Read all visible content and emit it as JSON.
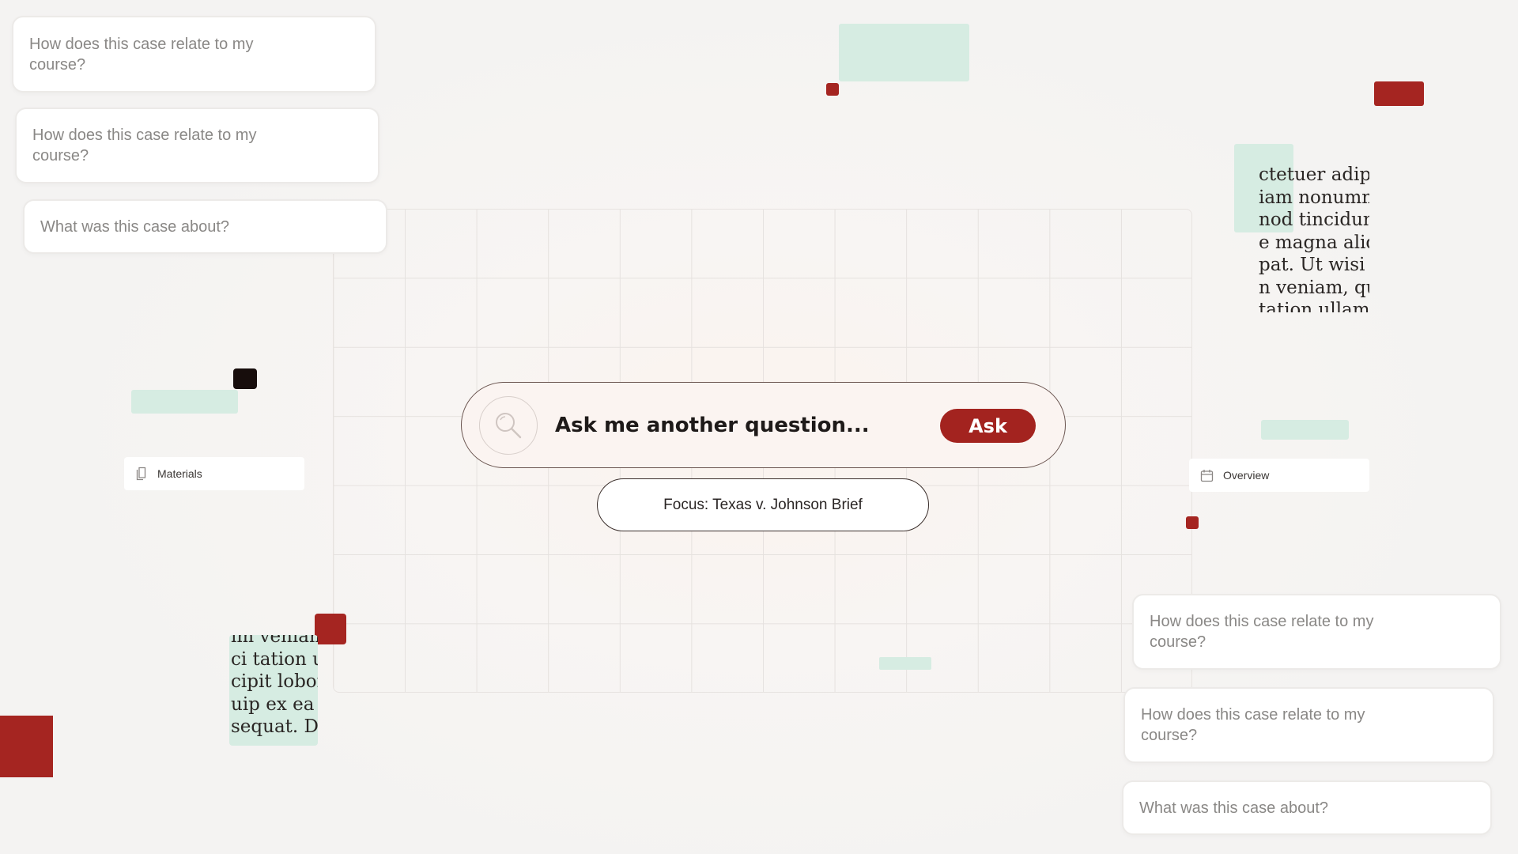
{
  "questions_left": [
    {
      "text": "How does this case relate to my course?"
    },
    {
      "text": "How does this case relate to my course?"
    },
    {
      "text": "What was this case about?"
    }
  ],
  "questions_right": [
    {
      "text": "How does this case relate to my course?"
    },
    {
      "text": "How does this case relate to my course?"
    },
    {
      "text": "What was this case about?"
    }
  ],
  "search": {
    "placeholder": "Ask me another question...",
    "button_label": "Ask",
    "icon": "search-icon"
  },
  "focus": {
    "label": "Focus: Texas v. Johnson Brief"
  },
  "tags": {
    "materials": {
      "label": "Materials",
      "icon": "document-icon"
    },
    "overview": {
      "label": "Overview",
      "icon": "calendar-icon"
    }
  },
  "snippets": {
    "top_right": [
      "ctetuer adip",
      "iam nonumm",
      "nod tincidunt",
      "e magna aliq",
      "pat. Ut wisi er",
      "n veniam, qui",
      "tation ullam"
    ],
    "bottom_left": [
      "im veniam,",
      "ci tation ull",
      "cipit lobortis",
      "uip ex ea co",
      "sequat. Dui",
      "....."
    ]
  },
  "colors": {
    "accent_red": "#a52521",
    "mint": "#d6ece2",
    "background": "#f6f4f2"
  }
}
